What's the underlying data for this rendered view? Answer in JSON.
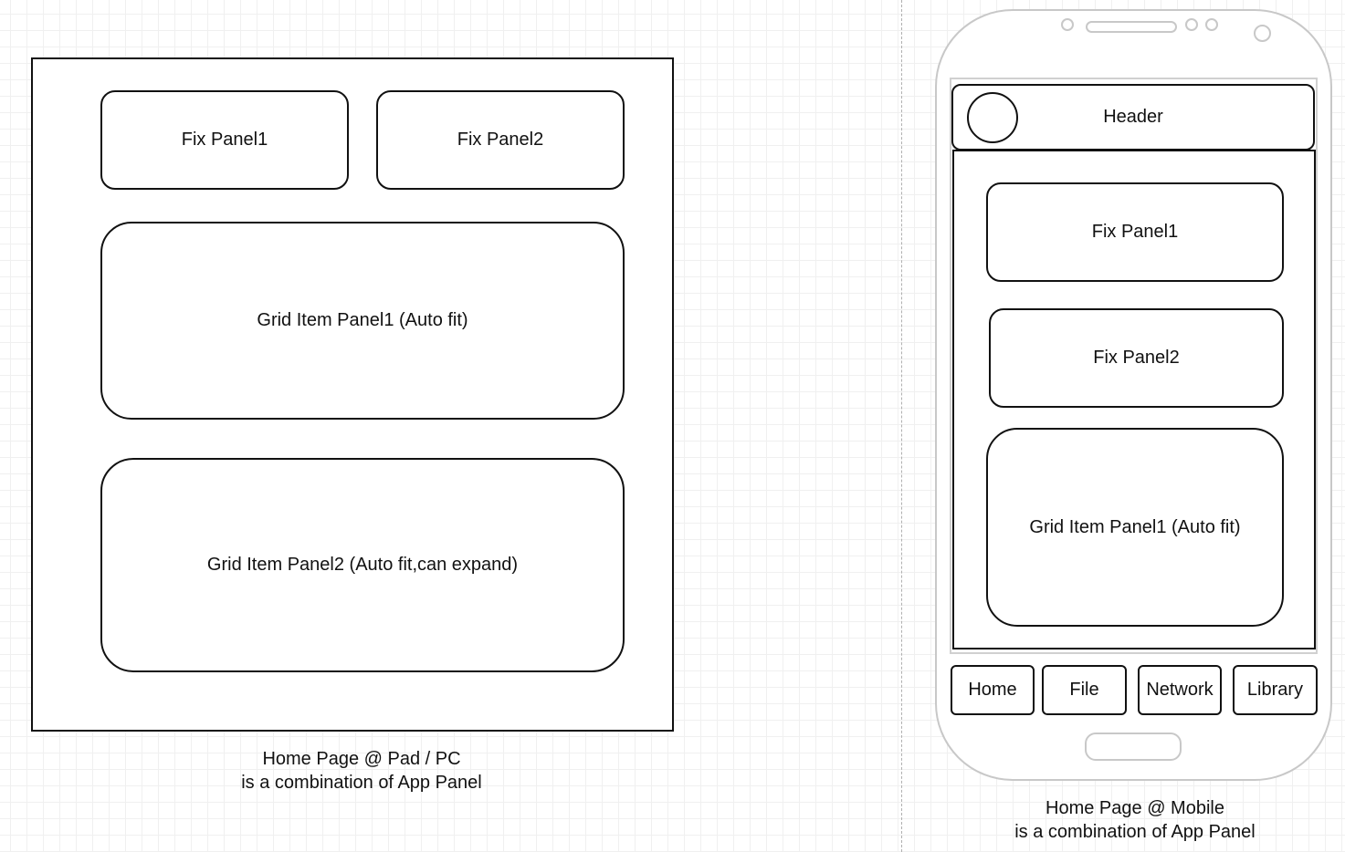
{
  "pad": {
    "fix_panel_1": "Fix Panel1",
    "fix_panel_2": "Fix Panel2",
    "grid_panel_1": "Grid Item Panel1 (Auto fit)",
    "grid_panel_2": "Grid Item Panel2 (Auto fit,can expand)",
    "caption_line1": "Home Page @ Pad / PC",
    "caption_line2": "is a combination of App Panel"
  },
  "mobile": {
    "header": "Header",
    "fix_panel_1": "Fix Panel1",
    "fix_panel_2": "Fix Panel2",
    "grid_panel_1": "Grid Item Panel1 (Auto fit)",
    "tabs": [
      "Home",
      "File",
      "Network",
      "Library"
    ],
    "caption_line1": "Home Page @ Mobile",
    "caption_line2": "is a combination of App Panel"
  },
  "colors": {
    "stroke": "#111111",
    "phone_outline": "#c8c8c8",
    "grid_line": "#dcdcdc"
  }
}
